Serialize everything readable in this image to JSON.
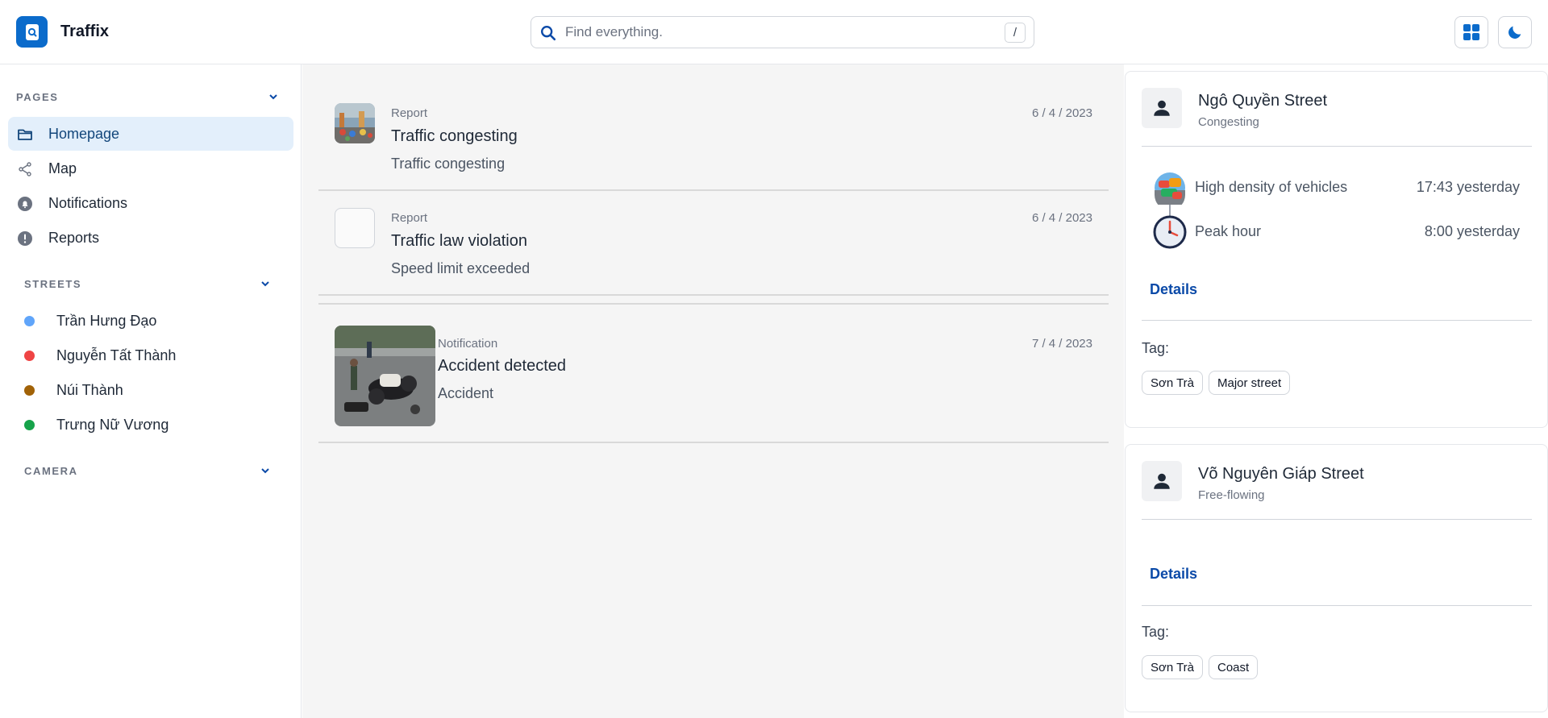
{
  "app": {
    "name": "Traffix"
  },
  "search": {
    "placeholder": "Find everything.",
    "value": "",
    "shortcut": "/"
  },
  "header": {
    "grid_icon": "grid-view-icon",
    "theme_icon": "moon-icon"
  },
  "sidebar": {
    "pages_title": "PAGES",
    "pages": [
      {
        "label": "Homepage",
        "icon": "folder-icon",
        "active": true
      },
      {
        "label": "Map",
        "icon": "share-icon"
      },
      {
        "label": "Notifications",
        "icon": "bell-icon"
      },
      {
        "label": "Reports",
        "icon": "alert-icon"
      }
    ],
    "streets_title": "STREETS",
    "streets": [
      {
        "label": "Trần Hưng Đạo",
        "color": "#60a5fa"
      },
      {
        "label": "Nguyễn Tất Thành",
        "color": "#ef4444"
      },
      {
        "label": "Núi Thành",
        "color": "#a16207"
      },
      {
        "label": "Trưng Nữ Vương",
        "color": "#16a34a"
      }
    ],
    "camera_title": "CAMERA"
  },
  "feed": [
    {
      "type": "Report",
      "date": "6 / 4 / 2023",
      "title": "Traffic congesting",
      "desc": "Traffic congesting",
      "image": "congestion-photo"
    },
    {
      "type": "Report",
      "date": "6 / 4 / 2023",
      "title": "Traffic law violation",
      "desc": "Speed limit exceeded",
      "image": "blank-photo"
    },
    {
      "type": "Notification",
      "date": "7 / 4 / 2023",
      "title": "Accident detected",
      "desc": "Accident",
      "image": "accident-photo"
    }
  ],
  "cards": [
    {
      "title": "Ngô Quyền Street",
      "status": "Congesting",
      "events": [
        {
          "label": "High density of vehicles",
          "time": "17:43 yesterday",
          "icon": "vehicles-icon"
        },
        {
          "label": "Peak hour",
          "time": "8:00 yesterday",
          "icon": "clock-icon"
        }
      ],
      "details_label": "Details",
      "tag_label": "Tag:",
      "tags": [
        "Sơn Trà",
        "Major street"
      ]
    },
    {
      "title": "Võ Nguyên Giáp Street",
      "status": "Free-flowing",
      "events": [],
      "details_label": "Details",
      "tag_label": "Tag:",
      "tags": [
        "Sơn Trà",
        "Coast"
      ]
    }
  ],
  "colors": {
    "accent": "#0b6bcb",
    "active_bg": "#e3effb",
    "link": "#0b4aa8"
  }
}
